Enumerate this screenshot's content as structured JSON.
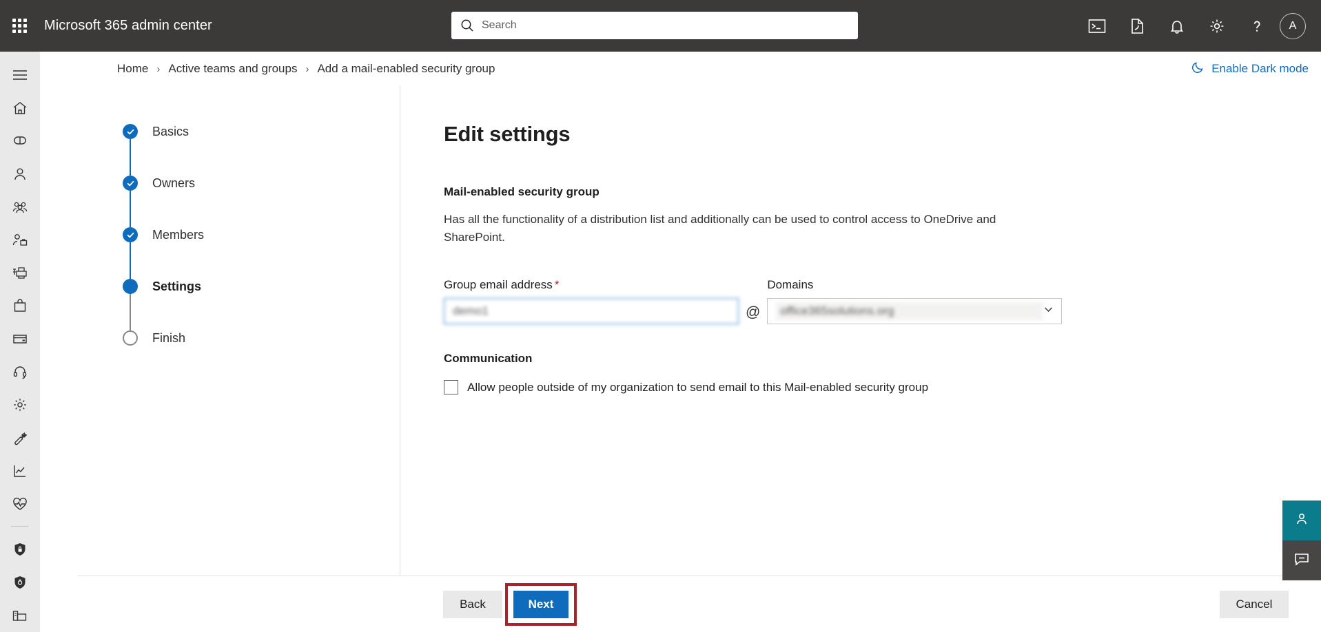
{
  "suite": {
    "app_title": "Microsoft 365 admin center",
    "waffle_icon": "app-launcher-waffle-icon",
    "search": {
      "placeholder": "Search",
      "value": "",
      "icon": "search-icon"
    },
    "actions": [
      {
        "name": "cloud-shell-icon",
        "label": "Cloud Shell"
      },
      {
        "name": "diagnostics-icon",
        "label": "Diagnostics"
      },
      {
        "name": "bell-icon",
        "label": "Notifications"
      },
      {
        "name": "gear-icon",
        "label": "Settings"
      },
      {
        "name": "help-icon",
        "label": "Help"
      }
    ],
    "avatar_initial": "A"
  },
  "rail": {
    "items": [
      {
        "name": "hamburger-icon",
        "label": "Show navigation menu"
      },
      {
        "name": "home-icon",
        "label": "Home"
      },
      {
        "name": "copilot-icon",
        "label": "Copilot"
      },
      {
        "name": "user-icon",
        "label": "Users"
      },
      {
        "name": "teams-groups-icon",
        "label": "Teams & groups"
      },
      {
        "name": "roles-icon",
        "label": "Roles"
      },
      {
        "name": "devices-icon",
        "label": "Devices"
      },
      {
        "name": "billing-bag-icon",
        "label": "Billing"
      },
      {
        "name": "payment-card-icon",
        "label": "Payment"
      },
      {
        "name": "support-headset-icon",
        "label": "Support"
      },
      {
        "name": "settings-gear-icon",
        "label": "Settings"
      },
      {
        "name": "setup-wrench-icon",
        "label": "Setup"
      },
      {
        "name": "reports-chart-icon",
        "label": "Reports"
      },
      {
        "name": "health-heart-icon",
        "label": "Health"
      },
      {
        "name": "security-shield-icon",
        "label": "Security"
      },
      {
        "name": "compliance-shield-icon",
        "label": "Compliance"
      },
      {
        "name": "admin-centers-icon",
        "label": "All admin centers"
      }
    ]
  },
  "breadcrumb": {
    "items": [
      "Home",
      "Active teams and groups",
      "Add a mail-enabled security group"
    ],
    "separator": "›"
  },
  "dark_mode": {
    "label": "Enable Dark mode",
    "icon": "moon-icon",
    "color": "#0f6cbd"
  },
  "wizard": {
    "steps": [
      {
        "label": "Basics",
        "state": "done"
      },
      {
        "label": "Owners",
        "state": "done"
      },
      {
        "label": "Members",
        "state": "done"
      },
      {
        "label": "Settings",
        "state": "current"
      },
      {
        "label": "Finish",
        "state": "todo"
      }
    ]
  },
  "main": {
    "title": "Edit settings",
    "group_type_heading": "Mail-enabled security group",
    "group_type_description": "Has all the functionality of a distribution list and additionally can be used to control access to OneDrive and SharePoint.",
    "email": {
      "label": "Group email address",
      "required_marker": "*",
      "value": "demo1",
      "at_symbol": "@"
    },
    "domains": {
      "label": "Domains",
      "selected": "office365solutions.org",
      "chevron_icon": "chevron-down-icon"
    },
    "communication": {
      "heading": "Communication",
      "checkbox_label": "Allow people outside of my organization to send email to this Mail-enabled security group",
      "checked": false
    }
  },
  "footer": {
    "back_label": "Back",
    "next_label": "Next",
    "cancel_label": "Cancel",
    "highlight_color": "#a4262c",
    "primary_color": "#0f6cbd"
  },
  "feedback": [
    {
      "name": "feedback-survey-tab",
      "icon": "person-feedback-icon",
      "color": "#0b7c8c"
    },
    {
      "name": "feedback-chat-tab",
      "icon": "chat-icon",
      "color": "#484644"
    }
  ]
}
